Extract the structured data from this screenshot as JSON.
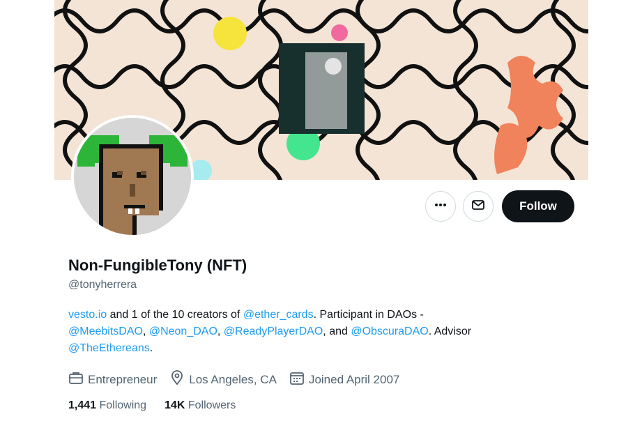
{
  "profile": {
    "name": "Non-FungibleTony (NFT)",
    "handle": "@tonyherrera",
    "bio": {
      "link1": "vesto.io",
      "text1": " and 1 of the 10 creators of ",
      "mention1": "@ether_cards",
      "text2": ". Participant in DAOs -",
      "mention2": "@MeebitsDAO",
      "sep1": ", ",
      "mention3": "@Neon_DAO",
      "sep2": ", ",
      "mention4": "@ReadyPlayerDAO",
      "sep3": ", and ",
      "mention5": "@ObscuraDAO",
      "text3": ". Advisor",
      "mention6": "@TheEthereans",
      "text4": "."
    },
    "meta": {
      "profession": "Entrepreneur",
      "location": "Los Angeles, CA",
      "joined": "Joined April 2007"
    },
    "stats": {
      "following_count": "1,441",
      "following_label": " Following",
      "followers_count": "14K",
      "followers_label": " Followers"
    }
  },
  "actions": {
    "follow_label": "Follow",
    "more_icon": "more-icon",
    "message_icon": "mail-icon"
  },
  "colors": {
    "link": "#1d9bf0",
    "banner_bg": "#f3e4d6",
    "follow_bg": "#0f1419",
    "muted": "#536471"
  }
}
